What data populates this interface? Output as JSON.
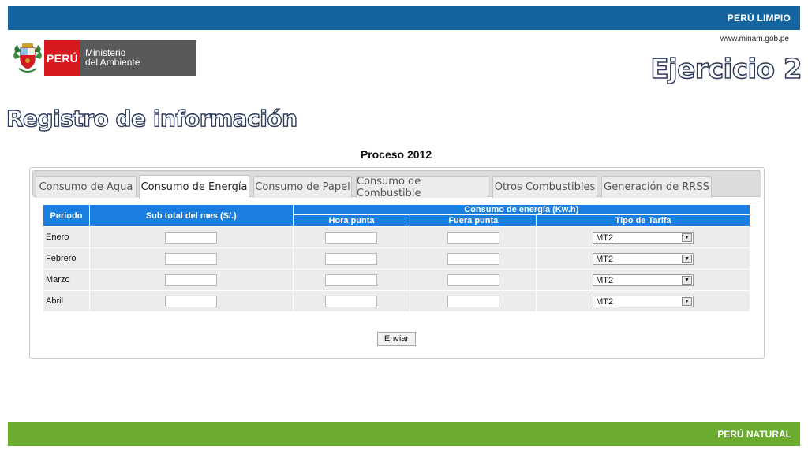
{
  "header": {
    "top_label": "PERÚ LIMPIO",
    "url": "www.minam.gob.pe"
  },
  "logo": {
    "country": "PERÚ",
    "ministry_line1": "Ministerio",
    "ministry_line2": "del Ambiente"
  },
  "exercise_title": "Ejercicio 2",
  "section_title": "Registro de información",
  "form": {
    "title": "Proceso 2012",
    "tabs": [
      {
        "label": "Consumo de Agua",
        "active": false
      },
      {
        "label": "Consumo de Energía",
        "active": true
      },
      {
        "label": "Consumo de Papel",
        "active": false
      },
      {
        "label": "Consumo de Combustible",
        "active": false
      },
      {
        "label": "Otros Combustibles",
        "active": false
      },
      {
        "label": "Generación de RRSS",
        "active": false
      }
    ],
    "table": {
      "col_periodo": "Periodo",
      "col_subtotal": "Sub total del mes (S/.)",
      "col_group": "Consumo de energía (Kw.h)",
      "col_hora_punta": "Hora punta",
      "col_fuera_punta": "Fuera punta",
      "col_tarifa": "Tipo de Tarifa",
      "rows": [
        {
          "periodo": "Enero",
          "subtotal": "",
          "hora_punta": "",
          "fuera_punta": "",
          "tarifa": "MT2"
        },
        {
          "periodo": "Febrero",
          "subtotal": "",
          "hora_punta": "",
          "fuera_punta": "",
          "tarifa": "MT2"
        },
        {
          "periodo": "Marzo",
          "subtotal": "",
          "hora_punta": "",
          "fuera_punta": "",
          "tarifa": "MT2"
        },
        {
          "periodo": "Abril",
          "subtotal": "",
          "hora_punta": "",
          "fuera_punta": "",
          "tarifa": "MT2"
        }
      ]
    },
    "submit_label": "Enviar"
  },
  "footer": {
    "bottom_label": "PERÚ NATURAL"
  },
  "colors": {
    "top_bar": "#1464a0",
    "bottom_bar": "#6bab2f",
    "table_header": "#1a7fe0",
    "logo_red": "#d71920",
    "logo_gray": "#58595b"
  }
}
